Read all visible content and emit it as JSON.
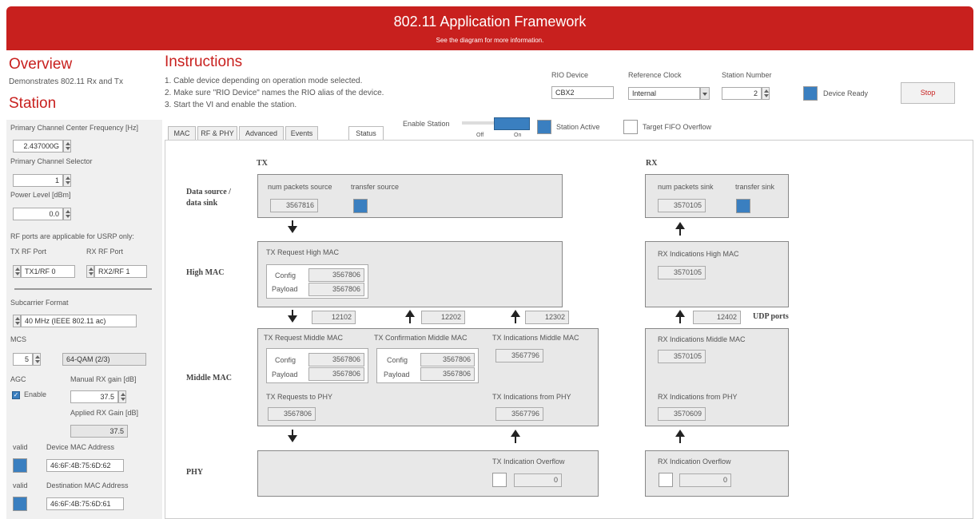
{
  "header": {
    "title": "802.11 Application Framework",
    "subtitle": "See the diagram for more information."
  },
  "overview": {
    "title": "Overview",
    "desc": "Demonstrates 802.11 Rx and Tx",
    "station": "Station"
  },
  "instructions": {
    "title": "Instructions",
    "lines": [
      "1. Cable device depending on operation mode selected.",
      "2. Make sure \"RIO Device\" names the RIO alias of the device.",
      "3. Start the VI and enable the station."
    ]
  },
  "rio": {
    "label": "RIO Device",
    "value": "CBX2"
  },
  "refclock": {
    "label": "Reference Clock",
    "value": "Internal"
  },
  "station_number": {
    "label": "Station Number",
    "value": "2"
  },
  "device_ready": "Device Ready",
  "stop": "Stop",
  "left": {
    "freq_label": "Primary Channel Center Frequency [Hz]",
    "freq_value": "2.437000G",
    "selector_label": "Primary Channel Selector",
    "selector_value": "1",
    "power_label": "Power Level [dBm]",
    "power_value": "0.0",
    "rf_note": "RF ports are applicable for USRP only:",
    "tx_port_label": "TX RF Port",
    "tx_port_value": "TX1/RF 0",
    "rx_port_label": "RX RF Port",
    "rx_port_value": "RX2/RF 1",
    "subcarrier_label": "Subcarrier Format",
    "subcarrier_value": "40 MHz (IEEE 802.11 ac)",
    "mcs_label": "MCS",
    "mcs_value": "5",
    "mcs_desc": "64-QAM (2/3)",
    "agc_label": "AGC",
    "agc_enable": "Enable",
    "manual_gain_label": "Manual RX gain [dB]",
    "manual_gain_value": "37.5",
    "applied_gain_label": "Applied RX Gain [dB]",
    "applied_gain_value": "37.5",
    "valid1": "valid",
    "device_mac_label": "Device MAC Address",
    "device_mac_value": "46:6F:4B:75:6D:62",
    "valid2": "valid",
    "dest_mac_label": "Destination MAC Address",
    "dest_mac_value": "46:6F:4B:75:6D:61"
  },
  "tabs": [
    "MAC",
    "RF & PHY",
    "Advanced",
    "Events",
    "Status"
  ],
  "enable_station": {
    "label": "Enable Station",
    "off": "Off",
    "on": "On"
  },
  "station_active": "Station Active",
  "fifo_overflow": "Target FIFO Overflow",
  "diagram": {
    "tx": "TX",
    "rx": "RX",
    "row_data": "Data source /\ndata sink",
    "row_high": "High MAC",
    "row_middle": "Middle MAC",
    "row_phy": "PHY",
    "num_packets_source": "num packets source",
    "transfer_source": "transfer source",
    "source_value": "3567816",
    "num_packets_sink": "num packets sink",
    "transfer_sink": "transfer sink",
    "sink_value": "3570105",
    "tx_req_high": "TX Request High MAC",
    "config": "Config",
    "payload": "Payload",
    "high_config": "3567806",
    "high_payload": "3567806",
    "rx_ind_high": "RX Indications High MAC",
    "rx_ind_high_value": "3570105",
    "port1": "12102",
    "port2": "12202",
    "port3": "12302",
    "port4": "12402",
    "udp_ports": "UDP ports",
    "tx_req_middle": "TX Request Middle MAC",
    "mid_config": "3567806",
    "mid_payload": "3567806",
    "tx_conf_middle": "TX Confirmation Middle MAC",
    "conf_config": "3567806",
    "conf_payload": "3567806",
    "tx_ind_middle": "TX Indications Middle MAC",
    "tx_ind_middle_value": "3567796",
    "tx_req_phy": "TX Requests to PHY",
    "tx_req_phy_value": "3567806",
    "tx_ind_phy": "TX Indications from PHY",
    "tx_ind_phy_value": "3567796",
    "rx_ind_middle": "RX Indications Middle MAC",
    "rx_ind_middle_value": "3570105",
    "rx_ind_phy": "RX Indications from PHY",
    "rx_ind_phy_value": "3570609",
    "tx_ind_overflow": "TX Indication Overflow",
    "tx_overflow_value": "0",
    "rx_ind_overflow": "RX Indication Overflow",
    "rx_overflow_value": "0"
  },
  "colors": {
    "header_red": "#c8201e",
    "led_blue": "#3a7fc0"
  }
}
